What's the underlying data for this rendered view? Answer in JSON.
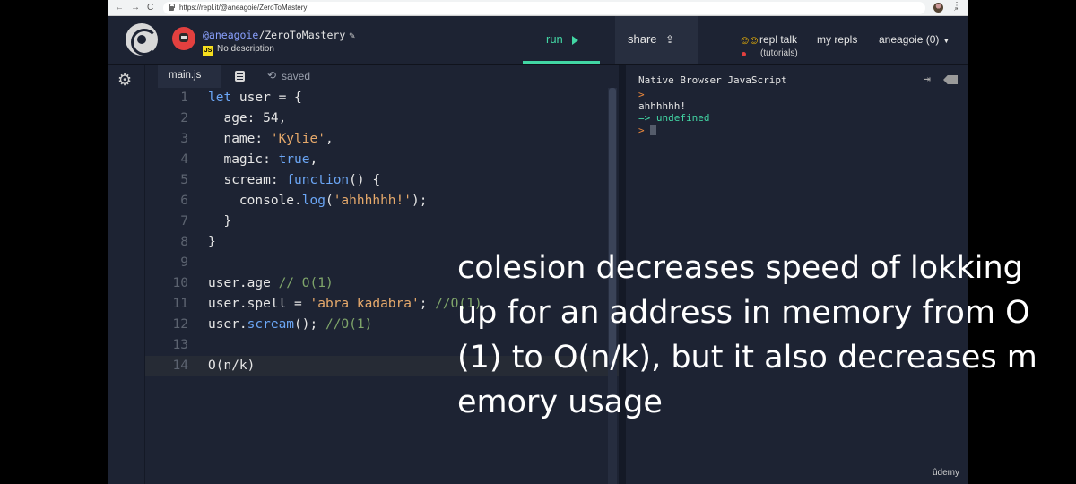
{
  "browser": {
    "url": "https://repl.it/@aneagoie/ZeroToMastery",
    "nav_back": "←",
    "nav_forward": "→",
    "nav_reload": "C"
  },
  "header": {
    "repl_owner": "@aneagoie",
    "repl_name": "/ZeroToMastery",
    "lang_badge": "JS",
    "description": "No description",
    "run_label": "run",
    "share_label": "share",
    "talk_label": "repl talk",
    "talk_sub": "(tutorials)",
    "myrepls_label": "my repls",
    "user_label": "aneagoie (0)"
  },
  "editor": {
    "tab_label": "main.js",
    "saved_label": "saved",
    "lines": [
      {
        "n": "1"
      },
      {
        "n": "2"
      },
      {
        "n": "3"
      },
      {
        "n": "4"
      },
      {
        "n": "5"
      },
      {
        "n": "6"
      },
      {
        "n": "7"
      },
      {
        "n": "8"
      },
      {
        "n": "9"
      },
      {
        "n": "10"
      },
      {
        "n": "11"
      },
      {
        "n": "12"
      },
      {
        "n": "13"
      },
      {
        "n": "14"
      }
    ]
  },
  "console": {
    "title": "Native Browser JavaScript",
    "prompt1": ">",
    "output": "ahhhhhh!",
    "result": "=> undefined",
    "prompt2": ">"
  },
  "watermark": "ûdemy",
  "caption": "colesion decreases speed of lokking up for an address in memory from O(1) to O(n/k), but it also decreases memory usage",
  "colors": {
    "accent_run": "#42d6a4",
    "keyword": "#6ba6f5",
    "string": "#e6a96b",
    "comment": "#7fa56a",
    "background": "#1d2333"
  }
}
